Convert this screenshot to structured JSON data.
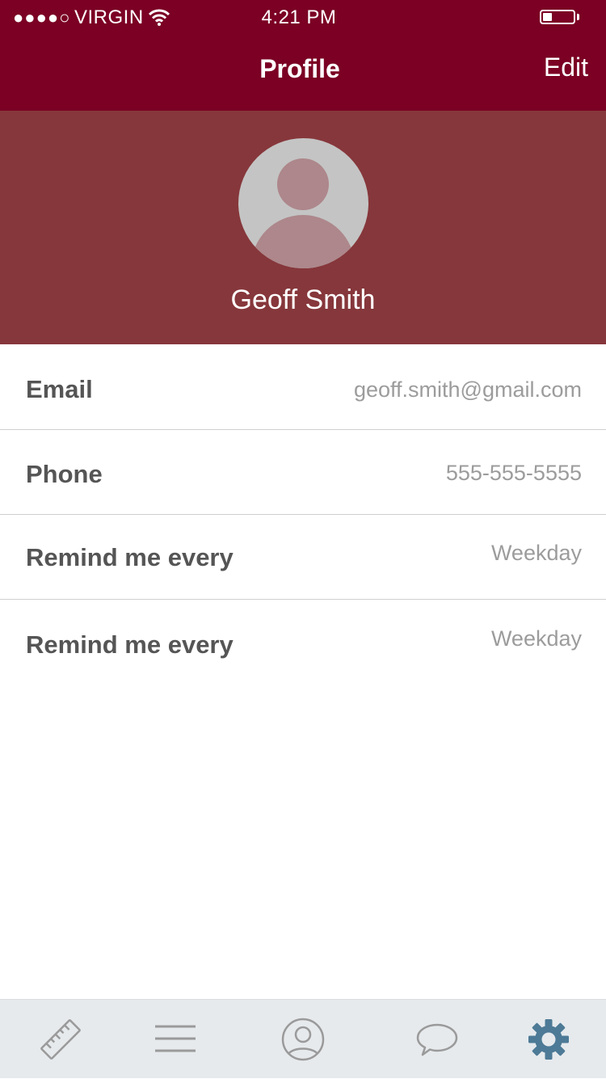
{
  "status_bar": {
    "signal": "●●●●○",
    "carrier": "VIRGIN",
    "time": "4:21 PM",
    "battery_level": 0.3
  },
  "nav": {
    "title": "Profile",
    "edit_label": "Edit"
  },
  "profile": {
    "name": "Geoff Smith"
  },
  "fields": [
    {
      "label": "Email",
      "value": "geoff.smith@gmail.com"
    },
    {
      "label": "Phone",
      "value": "555-555-5555"
    },
    {
      "label": "Remind me every",
      "value": "Weekday"
    },
    {
      "label": "Remind me every",
      "value": "Weekday"
    }
  ],
  "tab_bar": {
    "tabs": [
      {
        "icon": "ruler-icon",
        "active": false
      },
      {
        "icon": "menu-icon",
        "active": false
      },
      {
        "icon": "profile-icon",
        "active": false
      },
      {
        "icon": "chat-icon",
        "active": false
      },
      {
        "icon": "gear-icon",
        "active": true
      }
    ],
    "inactive_color": "#9a9a9a",
    "active_color": "#4d7a96"
  },
  "colors": {
    "nav_background": "#7b0024",
    "header_background": "#86373b"
  }
}
